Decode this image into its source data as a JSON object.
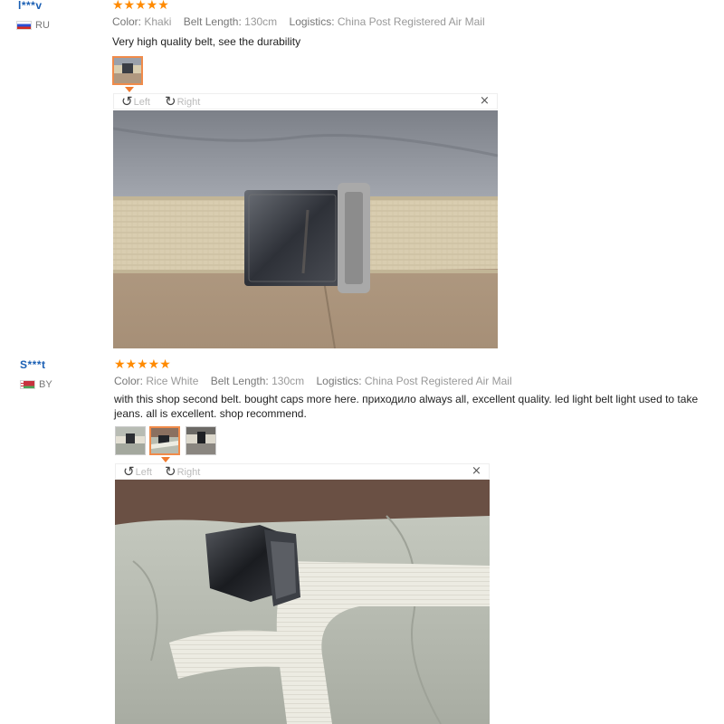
{
  "reviews": [
    {
      "user": "l***v",
      "country": "RU",
      "stars": "★★★★★",
      "color_label": "Color:",
      "color_value": "Khaki",
      "length_label": "Belt Length:",
      "length_value": "130cm",
      "logistics_label": "Logistics:",
      "logistics_value": "China Post Registered Air Mail",
      "comment": "Very high quality belt, see the durability",
      "rotate_left": "Left",
      "rotate_right": "Right",
      "close": "×"
    },
    {
      "user": "S***t",
      "country": "BY",
      "stars": "★★★★★",
      "color_label": "Color:",
      "color_value": "Rice White",
      "length_label": "Belt Length:",
      "length_value": "130cm",
      "logistics_label": "Logistics:",
      "logistics_value": "China Post Registered Air Mail",
      "comment": "with this shop second belt. bought caps more here. приходило always all, excellent quality. led light belt light used to take jeans. all is excellent. shop recommend.",
      "rotate_left": "Left",
      "rotate_right": "Right",
      "close": "×"
    }
  ],
  "icons": {
    "star": "star-icon",
    "rotate_left": "rotate-left-icon",
    "rotate_right": "rotate-right-icon",
    "close": "close-icon"
  },
  "colors": {
    "star": "#ff8a00",
    "username": "#1a5fb4",
    "active_thumb": "#f08b4a"
  }
}
